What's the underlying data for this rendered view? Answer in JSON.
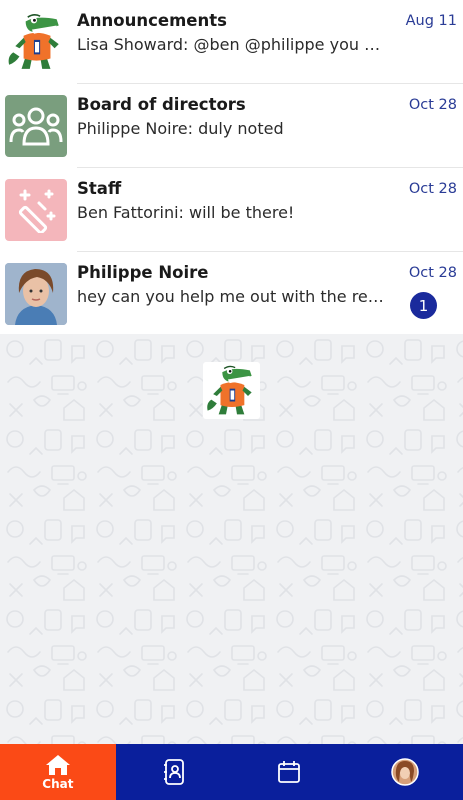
{
  "chats": [
    {
      "title": "Announcements",
      "preview": "Lisa Showard: @ben @philippe you are ...",
      "date": "Aug 11",
      "avatar_icon": "gator-mascot-icon",
      "unread": ""
    },
    {
      "title": "Board of directors",
      "preview": "Philippe Noire: duly noted",
      "date": "Oct 28",
      "avatar_icon": "group-icon",
      "avatar_color": "#7a9e7e",
      "unread": ""
    },
    {
      "title": "Staff",
      "preview": "Ben Fattorini: will be there!",
      "date": "Oct 28",
      "avatar_icon": "magic-wand-icon",
      "avatar_color": "#f4b6bb",
      "unread": ""
    },
    {
      "title": "Philippe Noire",
      "preview": "hey can you help me out with the repo...",
      "date": "Oct 28",
      "avatar_icon": "user-photo",
      "unread": "1"
    }
  ],
  "nav": {
    "chat_label": "Chat",
    "chat_icon": "home-icon",
    "contacts_icon": "contacts-icon",
    "calendar_icon": "calendar-icon",
    "profile_icon": "profile-avatar"
  },
  "colors": {
    "accent": "#fb4a16",
    "nav_bg": "#0a1f9c",
    "date": "#2a3c96",
    "badge": "#1a2a9c"
  }
}
